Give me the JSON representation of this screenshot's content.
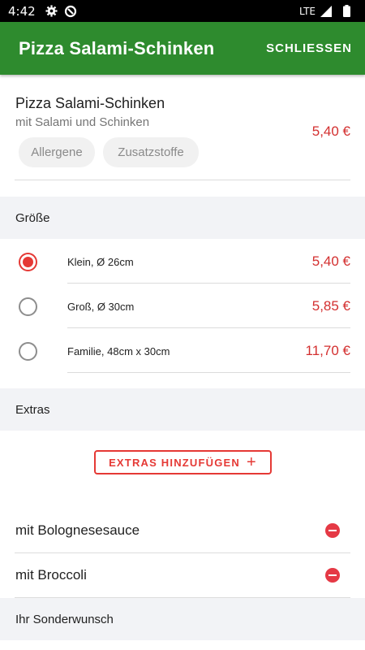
{
  "status_bar": {
    "time": "4:42",
    "network": "LTE",
    "icons": [
      "gear-icon",
      "data-saver-icon",
      "signal-icon",
      "battery-icon"
    ]
  },
  "app_bar": {
    "title": "Pizza Salami-Schinken",
    "close_label": "SCHLIESSEN",
    "color": "#2e8b2e"
  },
  "product": {
    "name": "Pizza Salami-Schinken",
    "description": "mit Salami und Schinken",
    "price": "5,40 €",
    "chips": [
      "Allergene",
      "Zusatzstoffe"
    ]
  },
  "size_section": {
    "header": "Größe",
    "options": [
      {
        "label": "Klein, Ø 26cm",
        "price": "5,40 €",
        "selected": true
      },
      {
        "label": "Groß, Ø 30cm",
        "price": "5,85 €",
        "selected": false
      },
      {
        "label": "Familie, 48cm x 30cm",
        "price": "11,70 €",
        "selected": false
      }
    ]
  },
  "extras_section": {
    "header": "Extras",
    "add_button_label": "EXTRAS HINZUFÜGEN",
    "add_button_icon": "plus-icon",
    "items": [
      {
        "label": "mit Bolognesesauce",
        "icon": "remove-icon"
      },
      {
        "label": "mit Broccoli",
        "icon": "remove-icon"
      }
    ]
  },
  "wish_section": {
    "header": "Ihr Sonderwunsch"
  },
  "colors": {
    "accent": "#e53935",
    "price": "#d32f2f",
    "section_bg": "#f2f3f6"
  }
}
